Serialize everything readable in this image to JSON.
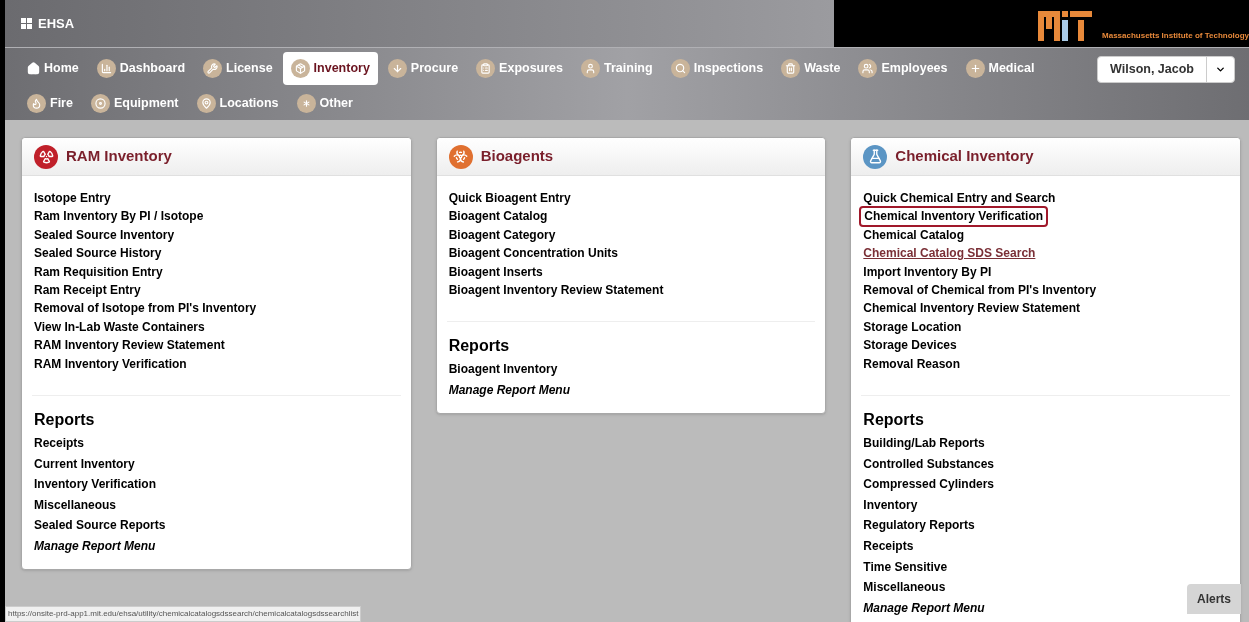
{
  "header": {
    "app_name": "EHSA",
    "institution": "Massachusetts Institute of Technology"
  },
  "nav": {
    "items": [
      {
        "label": "Home",
        "selected": false
      },
      {
        "label": "Dashboard",
        "selected": false
      },
      {
        "label": "License",
        "selected": false
      },
      {
        "label": "Inventory",
        "selected": true
      },
      {
        "label": "Procure",
        "selected": false
      },
      {
        "label": "Exposures",
        "selected": false
      },
      {
        "label": "Training",
        "selected": false
      },
      {
        "label": "Inspections",
        "selected": false
      },
      {
        "label": "Waste",
        "selected": false
      },
      {
        "label": "Employees",
        "selected": false
      },
      {
        "label": "Medical",
        "selected": false
      },
      {
        "label": "Fire",
        "selected": false
      },
      {
        "label": "Equipment",
        "selected": false
      },
      {
        "label": "Locations",
        "selected": false
      },
      {
        "label": "Other",
        "selected": false
      }
    ],
    "user": "Wilson, Jacob"
  },
  "cards": [
    {
      "title": "RAM Inventory",
      "links": [
        {
          "label": "Isotope Entry",
          "highlighted": false,
          "hovered": false
        },
        {
          "label": "Ram Inventory By PI / Isotope",
          "highlighted": false,
          "hovered": false
        },
        {
          "label": "Sealed Source Inventory",
          "highlighted": false,
          "hovered": false
        },
        {
          "label": "Sealed Source History",
          "highlighted": false,
          "hovered": false
        },
        {
          "label": "Ram Requisition Entry",
          "highlighted": false,
          "hovered": false
        },
        {
          "label": "Ram Receipt Entry",
          "highlighted": false,
          "hovered": false
        },
        {
          "label": "Removal of Isotope from PI's Inventory",
          "highlighted": false,
          "hovered": false
        },
        {
          "label": "View In-Lab Waste Containers",
          "highlighted": false,
          "hovered": false
        },
        {
          "label": "RAM Inventory Review Statement",
          "highlighted": false,
          "hovered": false
        },
        {
          "label": "RAM Inventory Verification",
          "highlighted": false,
          "hovered": false
        }
      ],
      "reports_heading": "Reports",
      "reports": [
        {
          "label": "Receipts",
          "kind": "link"
        },
        {
          "label": "Current Inventory",
          "kind": "link"
        },
        {
          "label": "Inventory Verification",
          "kind": "link"
        },
        {
          "label": "Miscellaneous",
          "kind": "link"
        },
        {
          "label": "Sealed Source Reports",
          "kind": "link"
        },
        {
          "label": "Manage Report Menu",
          "kind": "manage"
        }
      ]
    },
    {
      "title": "Bioagents",
      "links": [
        {
          "label": "Quick Bioagent Entry",
          "highlighted": false,
          "hovered": false
        },
        {
          "label": "Bioagent Catalog",
          "highlighted": false,
          "hovered": false
        },
        {
          "label": "Bioagent Category",
          "highlighted": false,
          "hovered": false
        },
        {
          "label": "Bioagent Concentration Units",
          "highlighted": false,
          "hovered": false
        },
        {
          "label": "Bioagent Inserts",
          "highlighted": false,
          "hovered": false
        },
        {
          "label": "Bioagent Inventory Review Statement",
          "highlighted": false,
          "hovered": false
        }
      ],
      "reports_heading": "Reports",
      "reports": [
        {
          "label": "Bioagent Inventory",
          "kind": "link"
        },
        {
          "label": "Manage Report Menu",
          "kind": "manage"
        }
      ]
    },
    {
      "title": "Chemical Inventory",
      "links": [
        {
          "label": "Quick Chemical Entry and Search",
          "highlighted": false,
          "hovered": false
        },
        {
          "label": "Chemical Inventory Verification",
          "highlighted": true,
          "hovered": false
        },
        {
          "label": "Chemical Catalog",
          "highlighted": false,
          "hovered": false
        },
        {
          "label": "Chemical Catalog SDS Search",
          "highlighted": false,
          "hovered": true
        },
        {
          "label": "Import Inventory By PI",
          "highlighted": false,
          "hovered": false
        },
        {
          "label": "Removal of Chemical from PI's Inventory",
          "highlighted": false,
          "hovered": false
        },
        {
          "label": "Chemical Inventory Review Statement",
          "highlighted": false,
          "hovered": false
        },
        {
          "label": "Storage Location",
          "highlighted": false,
          "hovered": false
        },
        {
          "label": "Storage Devices",
          "highlighted": false,
          "hovered": false
        },
        {
          "label": "Removal Reason",
          "highlighted": false,
          "hovered": false
        }
      ],
      "reports_heading": "Reports",
      "reports": [
        {
          "label": "Building/Lab Reports",
          "kind": "link"
        },
        {
          "label": "Controlled Substances",
          "kind": "link"
        },
        {
          "label": "Compressed Cylinders",
          "kind": "link"
        },
        {
          "label": "Inventory",
          "kind": "link"
        },
        {
          "label": "Regulatory Reports",
          "kind": "link"
        },
        {
          "label": "Receipts",
          "kind": "link"
        },
        {
          "label": "Time Sensitive",
          "kind": "link"
        },
        {
          "label": "Miscellaneous",
          "kind": "link"
        },
        {
          "label": "Manage Report Menu",
          "kind": "manage"
        }
      ]
    }
  ],
  "status_url": "https://onsite-prd-app1.mit.edu/ehsa/utility/chemicalcatalogsdssearch/chemicalcatalogsdssearchlist",
  "alerts_button": "Alerts"
}
